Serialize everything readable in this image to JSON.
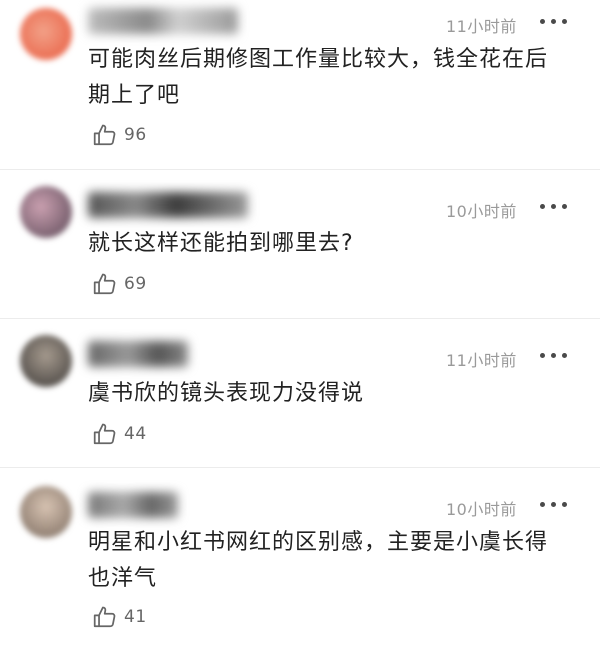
{
  "colors": {
    "background": "#ffffff",
    "text": "#222222",
    "meta": "#9a9a9a",
    "like_count": "#666666",
    "divider": "#ececec"
  },
  "comments": [
    {
      "time": "11小时前",
      "text": "可能肉丝后期修图工作量比较大，钱全花在后期上了吧",
      "likes": "96",
      "avatar_colors": [
        "#f2a188",
        "#e8593d"
      ],
      "username_color": "#9a9a9a"
    },
    {
      "time": "10小时前",
      "text": "就长这样还能拍到哪里去?",
      "likes": "69",
      "avatar_colors": [
        "#caa0b0",
        "#5a4856"
      ],
      "username_color": "#7e7e7e"
    },
    {
      "time": "11小时前",
      "text": "虞书欣的镜头表现力没得说",
      "likes": "44",
      "avatar_colors": [
        "#a59a8e",
        "#3d3a38"
      ],
      "username_color": "#8a8a8a"
    },
    {
      "time": "10小时前",
      "text": "明星和小红书网红的区别感，主要是小虞长得也洋气",
      "likes": "41",
      "avatar_colors": [
        "#d7c3b2",
        "#7a6a5e"
      ],
      "username_color": "#8e8e8e"
    }
  ],
  "icons": {
    "more": "more-options-icon",
    "like": "thumbs-up-icon"
  }
}
